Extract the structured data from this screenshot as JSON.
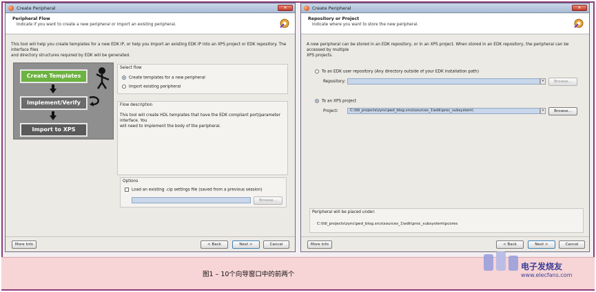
{
  "left_window": {
    "title": "Create Peripheral",
    "header_title": "Peripheral Flow",
    "header_subtitle": "Indicate if you want to create a new peripheral or import an existing peripheral.",
    "intro_line1": "This tool will help you create templates for a new EDK IP, or help you import an existing EDK IP into an XPS project or EDK repository. The interface files",
    "intro_line2": "and directory structures required by EDK will be generated.",
    "flow_steps": [
      "Create Templates",
      "Implement/Verify",
      "Import to XPS"
    ],
    "select_flow": {
      "title": "Select flow",
      "options": [
        "Create templates for a new peripheral",
        "Import existing peripheral"
      ],
      "selected_index": 0
    },
    "flow_description": {
      "title": "Flow description",
      "line1": "This tool will create HDL templates that have the EDK compliant port/parameter interface. You",
      "line2": "will need to implement the body of the peripheral."
    },
    "options": {
      "title": "Options",
      "checkbox_label": "Load an existing .cip settings file (saved from a previous session)",
      "browse": "Browse..."
    },
    "buttons": {
      "more_info": "More Info",
      "back": "< Back",
      "next": "Next >",
      "cancel": "Cancel"
    }
  },
  "right_window": {
    "title": "Create Peripheral",
    "header_title": "Repository or Project",
    "header_subtitle": "Indicate where you want to store the new peripheral.",
    "intro_line1": "A new peripheral can be stored in an EDK repository, or in an XPS project. When stored in an EDK repository, the peripheral can be accessed by multiple",
    "intro_line2": "XPS projects.",
    "repo_option": "To an EDK user repository (Any directory outside of your EDK installation path)",
    "repo_label": "Repository:",
    "repo_value": "",
    "xps_option": "To an XPS project",
    "project_label": "Project:",
    "project_value": "C:\\fdl_projects\\zync\\ped_blog.srcs\\sources_1\\edk\\proc_subsystem\\",
    "browse": "Browse...",
    "placed_title": "Peripheral will be placed under:",
    "placed_path": "C:\\fdl_projects\\zync\\ped_blog.srcs\\sources_1\\edk\\proc_subsystem\\pcores",
    "buttons": {
      "more_info": "More Info",
      "back": "< Back",
      "next": "Next >",
      "cancel": "Cancel"
    }
  },
  "caption": "图1 – 10个向导窗口中的前两个",
  "watermark": {
    "brand": "电子发烧友",
    "url": "www.elecfans.com"
  }
}
